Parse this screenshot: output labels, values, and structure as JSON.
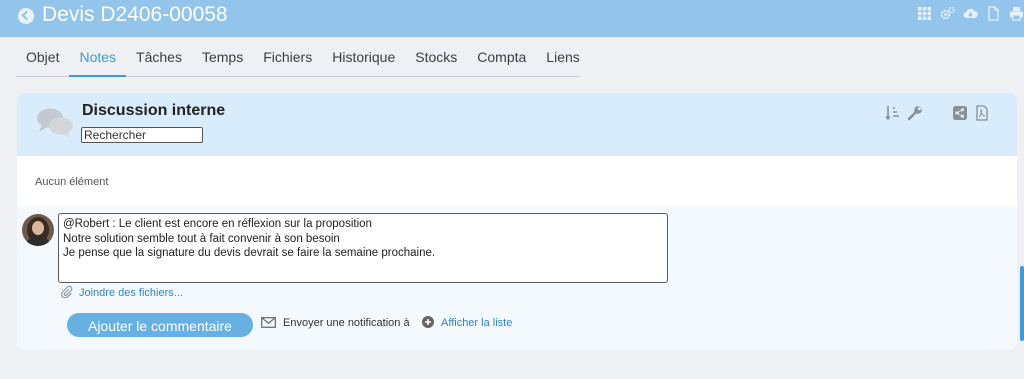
{
  "header": {
    "title": "Devis D2406-00058",
    "icons": [
      "grid-icon",
      "settings-cogs-icon",
      "cloud-download-icon",
      "document-icon",
      "print-icon"
    ]
  },
  "tabs": [
    {
      "label": "Objet"
    },
    {
      "label": "Notes"
    },
    {
      "label": "Tâches"
    },
    {
      "label": "Temps"
    },
    {
      "label": "Fichiers"
    },
    {
      "label": "Historique"
    },
    {
      "label": "Stocks"
    },
    {
      "label": "Compta"
    },
    {
      "label": "Liens"
    }
  ],
  "active_tab": "Notes",
  "discussion": {
    "title": "Discussion interne",
    "search_value": "Rechercher",
    "empty_text": "Aucun élément",
    "comment_lines": [
      "@Robert  : Le client est encore en réflexion sur la proposition",
      "Notre solution semble tout à fait convenir à son besoin",
      "Je pense que la signature du devis devrait se faire la semaine prochaine."
    ],
    "attach_label": "Joindre des fichiers...",
    "submit_label": "Ajouter le commentaire",
    "notify_label": "Envoyer une notification à",
    "show_list_label": "Afficher la liste"
  },
  "colors": {
    "header_bg": "#92c4ec",
    "accent": "#3d9ad9",
    "button": "#66b0e4"
  }
}
